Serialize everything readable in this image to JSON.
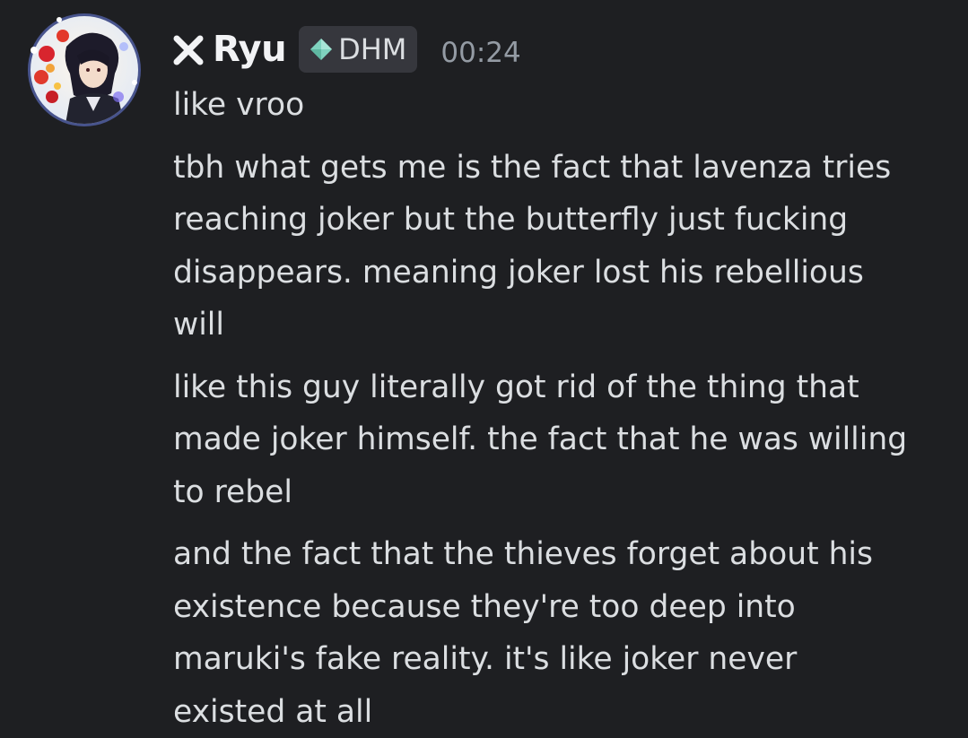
{
  "author": {
    "name": "Ryu",
    "prefix_icon": "x-icon",
    "tag": {
      "label": "DHM",
      "icon": "gem-icon",
      "color": "#8fd8c8"
    },
    "timestamp": "00:24",
    "avatar": "avatar"
  },
  "messages": [
    {
      "lines": [
        "like vroo"
      ]
    },
    {
      "lines": [
        "tbh what gets me is the fact that lavenza tries",
        "reaching joker but the butterfly just fucking",
        "disappears. meaning joker lost his rebellious",
        "will"
      ]
    },
    {
      "lines": [
        "like this guy literally got rid of the thing that",
        "made joker himself. the fact that he was willing",
        "to rebel"
      ]
    },
    {
      "lines": [
        "and the fact that the thieves forget about his",
        "existence because they're too deep into",
        "maruki's fake reality. it's like joker never",
        "existed at all"
      ]
    }
  ],
  "colors": {
    "background": "#1e1f22",
    "text": "#dbdee1",
    "username": "#f2f3f5",
    "timestamp": "#949ba4"
  }
}
